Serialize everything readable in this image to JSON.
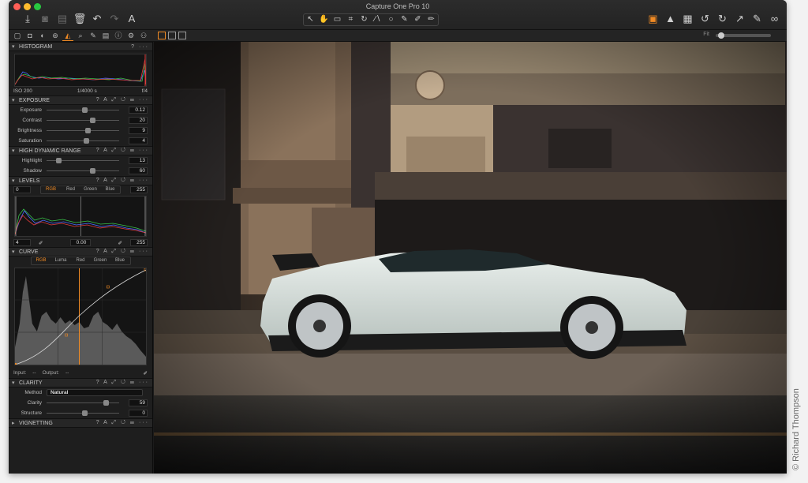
{
  "window": {
    "title": "Capture One Pro 10"
  },
  "toolbar": {
    "left_icons": [
      "import-icon",
      "camera-icon",
      "folder-icon",
      "trash-icon",
      "undo-icon",
      "redo-icon",
      "text-tool-icon"
    ],
    "cursor_tools": [
      "select-cursor-icon",
      "pan-cursor-icon",
      "loupe-cursor-icon",
      "crop-cursor-icon",
      "rotate-cursor-icon",
      "keystone-cursor-icon",
      "spot-cursor-icon",
      "brush-cursor-icon",
      "eraser-cursor-icon",
      "picker-cursor-icon"
    ],
    "right_icons": [
      "layers-icon",
      "warning-icon",
      "grid-icon",
      "rotate-left-icon",
      "rotate-right-icon",
      "export-icon",
      "edit-icon",
      "glasses-icon"
    ]
  },
  "subbar": {
    "fit_label": "Fit"
  },
  "histogram": {
    "title": "HISTOGRAM",
    "iso": "ISO 200",
    "shutter": "1/4000 s",
    "aperture": "f/4"
  },
  "exposure": {
    "title": "EXPOSURE",
    "rows": [
      {
        "label": "Exposure",
        "value": "0.12",
        "pos": 0.5
      },
      {
        "label": "Contrast",
        "value": "20",
        "pos": 0.6
      },
      {
        "label": "Brightness",
        "value": "9",
        "pos": 0.55
      },
      {
        "label": "Saturation",
        "value": "4",
        "pos": 0.52
      }
    ]
  },
  "hdr": {
    "title": "HIGH DYNAMIC RANGE",
    "rows": [
      {
        "label": "Highlight",
        "value": "13",
        "pos": 0.13
      },
      {
        "label": "Shadow",
        "value": "60",
        "pos": 0.6
      }
    ]
  },
  "levels": {
    "title": "LEVELS",
    "channels": [
      "RGB",
      "Red",
      "Green",
      "Blue"
    ],
    "active_channel": "RGB",
    "output_low": "0",
    "output_high": "255",
    "input_low": "4",
    "midtone": "0.00",
    "input_high": "255"
  },
  "curve": {
    "title": "CURVE",
    "channels": [
      "RGB",
      "Luma",
      "Red",
      "Green",
      "Blue"
    ],
    "active_channel": "RGB",
    "input_label": "Input:",
    "input_value": "--",
    "output_label": "Output:",
    "output_value": "--"
  },
  "clarity": {
    "title": "CLARITY",
    "method_label": "Method",
    "method_value": "Natural",
    "rows": [
      {
        "label": "Clarity",
        "value": "59",
        "pos": 0.59
      },
      {
        "label": "Structure",
        "value": "0",
        "pos": 0.5
      }
    ]
  },
  "vignetting": {
    "title": "VIGNETTING"
  },
  "credit": "© Richard Thompson",
  "colors": {
    "accent": "#f08a24",
    "panel": "#1e1e1e"
  }
}
